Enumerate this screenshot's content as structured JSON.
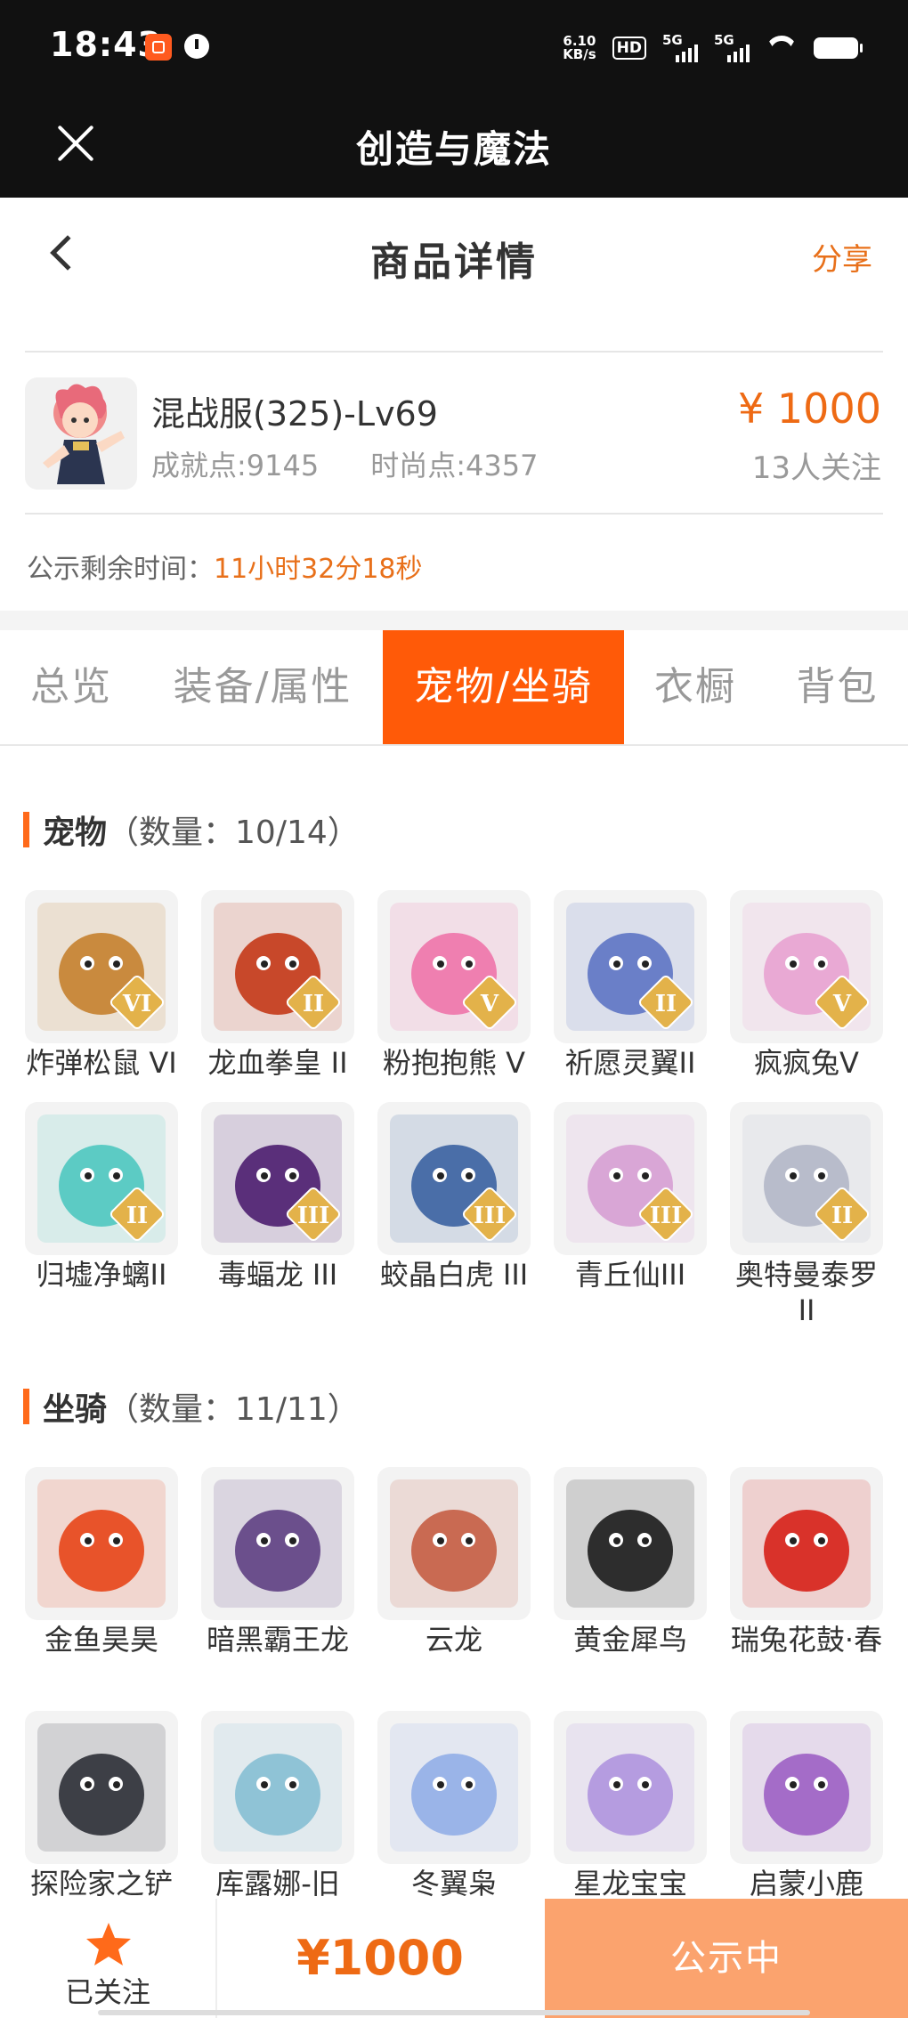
{
  "status_bar": {
    "time": "18:43",
    "net_speed_value": "6.10",
    "net_speed_unit": "KB/s",
    "hd_label": "HD",
    "signal1_label": "5G",
    "signal2_label": "5G"
  },
  "app_bar": {
    "title": "创造与魔法"
  },
  "page_header": {
    "title": "商品详情",
    "share_label": "分享"
  },
  "product": {
    "name": "混战服(325)-Lv69",
    "achievement": "成就点:9145",
    "fashion": "时尚点:4357",
    "price": "¥ 1000",
    "followers": "13人关注",
    "notice_label": "公示剩余时间：",
    "notice_time": "11小时32分18秒"
  },
  "tabs": [
    {
      "label": "总览",
      "active": false
    },
    {
      "label": "装备/属性",
      "active": false
    },
    {
      "label": "宠物/坐骑",
      "active": true
    },
    {
      "label": "衣橱",
      "active": false
    },
    {
      "label": "背包",
      "active": false
    }
  ],
  "pets": {
    "title": "宠物",
    "count": "（数量：10/14）",
    "items": [
      {
        "name": "炸弹松鼠 VI",
        "tier": "VI",
        "color": "#c98a3e",
        "icon": "squirrel-icon"
      },
      {
        "name": "龙血拳皇 II",
        "tier": "II",
        "color": "#c8482a",
        "icon": "dragon-fist-icon"
      },
      {
        "name": "粉抱抱熊 V",
        "tier": "V",
        "color": "#ef7fb0",
        "icon": "pink-bear-icon"
      },
      {
        "name": "祈愿灵翼II",
        "tier": "II",
        "color": "#6a7fc8",
        "icon": "spirit-wing-icon"
      },
      {
        "name": "疯疯兔V",
        "tier": "V",
        "color": "#e9a9d4",
        "icon": "crazy-rabbit-icon"
      },
      {
        "name": "归墟净螭II",
        "tier": "II",
        "color": "#5ccbc4",
        "icon": "water-dragon-icon"
      },
      {
        "name": "毒蝠龙 III",
        "tier": "III",
        "color": "#5a2f7a",
        "icon": "bat-dragon-icon"
      },
      {
        "name": "蛟晶白虎 III",
        "tier": "III",
        "color": "#4a6ea8",
        "icon": "white-tiger-icon"
      },
      {
        "name": "青丘仙III",
        "tier": "III",
        "color": "#d9a6d6",
        "icon": "fox-fairy-icon"
      },
      {
        "name": "奥特曼泰罗II",
        "tier": "II",
        "color": "#b8bccb",
        "icon": "ultraman-icon"
      }
    ]
  },
  "mounts": {
    "title": "坐骑",
    "count": "（数量：11/11）",
    "items": [
      {
        "name": "金鱼昊昊",
        "color": "#e8532a",
        "icon": "goldfish-icon"
      },
      {
        "name": "暗黑霸王龙",
        "color": "#6b4f8c",
        "icon": "dark-trex-icon"
      },
      {
        "name": "云龙",
        "color": "#c96a52",
        "icon": "cloud-dragon-icon"
      },
      {
        "name": "黄金犀鸟",
        "color": "#2d2d2d",
        "icon": "hornbill-icon"
      },
      {
        "name": "瑞兔花鼓·春",
        "color": "#d9322a",
        "icon": "rabbit-drum-icon"
      },
      {
        "name": "探险家之铲",
        "color": "#3d3f46",
        "icon": "shovel-icon"
      },
      {
        "name": "库露娜-旧",
        "color": "#8fc3d6",
        "icon": "kuluna-icon"
      },
      {
        "name": "冬翼枭",
        "color": "#9ab4e8",
        "icon": "winter-owl-icon"
      },
      {
        "name": "星龙宝宝",
        "color": "#b59ce0",
        "icon": "star-dragon-icon"
      },
      {
        "name": "启蒙小鹿",
        "color": "#a46cc8",
        "icon": "little-deer-icon"
      }
    ]
  },
  "bottom_bar": {
    "follow_label": "已关注",
    "price": "¥1000",
    "status_label": "公示中"
  },
  "colors": {
    "accent": "#ff5a08",
    "price": "#ee6a14",
    "status_button": "#fba36e"
  }
}
